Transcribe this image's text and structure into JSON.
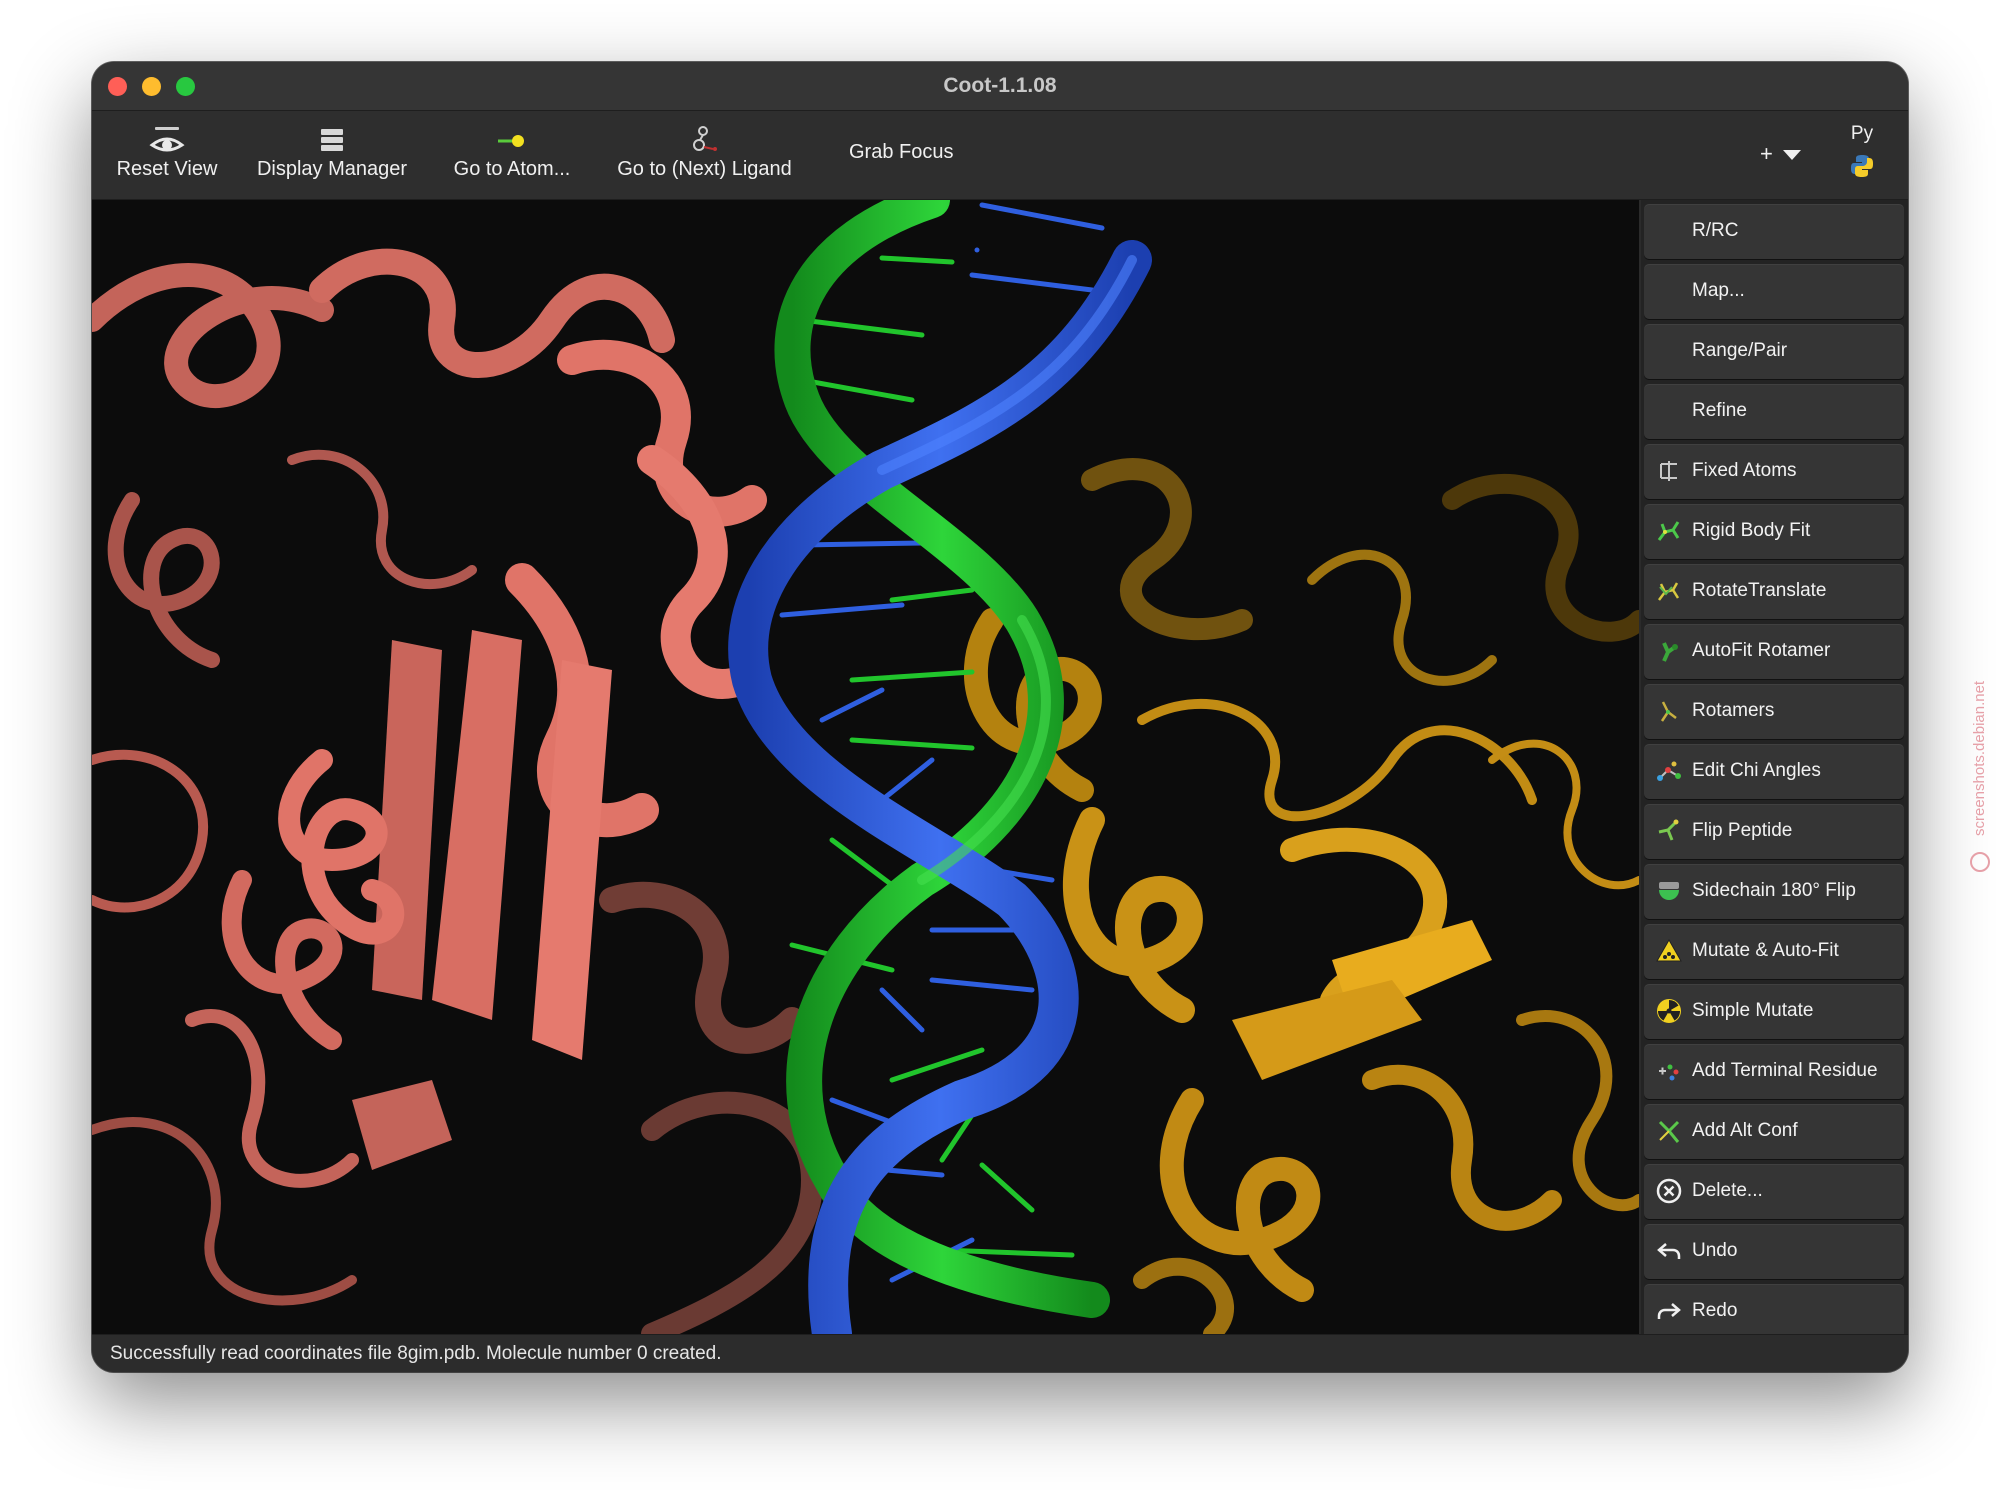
{
  "window": {
    "title": "Coot-1.1.08"
  },
  "toolbar": {
    "buttons": [
      {
        "label": "Reset View",
        "icon": "eye-icon"
      },
      {
        "label": "Display Manager",
        "icon": "list-icon"
      },
      {
        "label": "Go to Atom...",
        "icon": "atom-pointer-icon"
      },
      {
        "label": "Go to (Next) Ligand",
        "icon": "ligand-icon"
      }
    ],
    "grab_focus": "Grab Focus",
    "plus_label": "+",
    "python_label": "Py"
  },
  "sidebar": {
    "buttons": [
      {
        "label": "R/RC",
        "icon": ""
      },
      {
        "label": "Map...",
        "icon": ""
      },
      {
        "label": "Range/Pair",
        "icon": ""
      },
      {
        "label": "Refine",
        "icon": ""
      },
      {
        "label": "Fixed Atoms",
        "icon": "fixed-atoms-icon"
      },
      {
        "label": "Rigid Body Fit",
        "icon": "rigid-body-icon"
      },
      {
        "label": "RotateTranslate",
        "icon": "rotate-translate-icon"
      },
      {
        "label": "AutoFit Rotamer",
        "icon": "autofit-rotamer-icon"
      },
      {
        "label": "Rotamers",
        "icon": "rotamers-icon"
      },
      {
        "label": "Edit Chi Angles",
        "icon": "chi-angles-icon"
      },
      {
        "label": "Flip Peptide",
        "icon": "flip-peptide-icon"
      },
      {
        "label": "Sidechain 180° Flip",
        "icon": "sidechain-flip-icon"
      },
      {
        "label": "Mutate & Auto-Fit",
        "icon": "mutate-autofit-icon"
      },
      {
        "label": "Simple Mutate",
        "icon": "simple-mutate-icon"
      },
      {
        "label": "Add Terminal Residue",
        "icon": "add-terminal-residue-icon"
      },
      {
        "label": "Add Alt Conf",
        "icon": "add-alt-conf-icon"
      },
      {
        "label": "Delete...",
        "icon": "delete-icon"
      },
      {
        "label": "Undo",
        "icon": "undo-icon"
      },
      {
        "label": "Redo",
        "icon": "redo-icon"
      }
    ]
  },
  "status": {
    "text": "Successfully read coordinates file 8gim.pdb.  Molecule number 0 created."
  },
  "viewer": {
    "colors": {
      "protein_a": "#e07468",
      "protein_b": "#d49a1a",
      "dna_strand_1": "#2f5fe0",
      "dna_strand_2": "#21c52c",
      "background": "#0c0c0c"
    }
  },
  "watermark": "screenshots.debian.net"
}
